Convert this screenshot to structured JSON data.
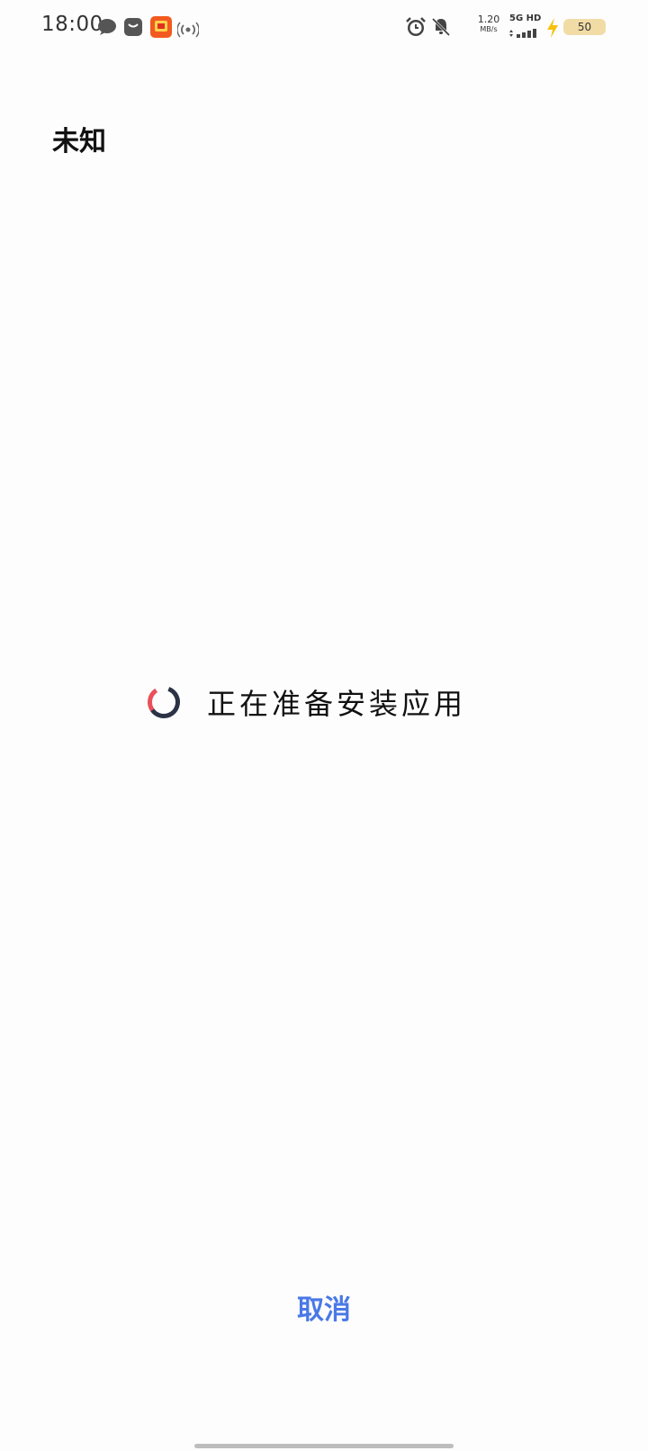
{
  "status_bar": {
    "time": "18:00",
    "speed_value": "1.20",
    "speed_unit": "MB/s",
    "network": "5G HD",
    "battery": "50",
    "icons": [
      "chat-bubble-icon",
      "message-icon",
      "taobao-app-icon",
      "hotspot-icon",
      "alarm-icon",
      "mute-bell-icon",
      "signal-icon",
      "charging-icon"
    ]
  },
  "title": "未知",
  "loading": {
    "text": "正在准备安装应用"
  },
  "cancel_label": "取消",
  "colors": {
    "accent": "#4a78e6",
    "spinner_red": "#e8505b",
    "spinner_dark": "#2b3345",
    "battery": "#f2dca6"
  }
}
